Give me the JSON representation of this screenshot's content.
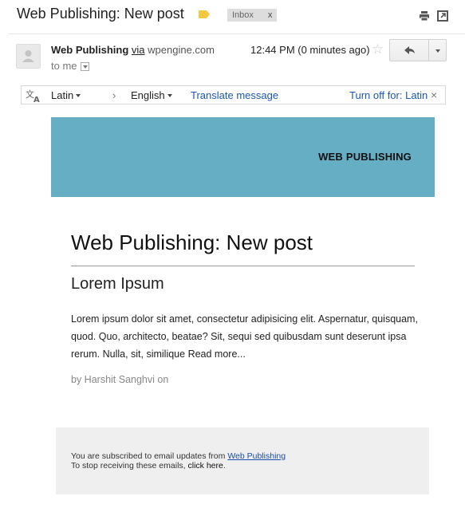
{
  "header": {
    "subject": "Web Publishing: New post",
    "label_chip": "Inbox",
    "label_chip_close": "x",
    "icons": [
      "label-tag-icon",
      "print-icon",
      "new-window-icon"
    ]
  },
  "sender": {
    "name": "Web Publishing",
    "via": "via",
    "domain": "wpengine.com",
    "to": "to me",
    "time": "12:44 PM (0 minutes ago)",
    "star": "☆"
  },
  "translate_bar": {
    "from_lang": "Latin",
    "arrow": "›",
    "to_lang": "English",
    "action": "Translate message",
    "turn_off": "Turn off for: Latin",
    "close": "×"
  },
  "email": {
    "banner_title": "WEB PUBLISHING",
    "banner_color": "#66aec4",
    "post_title": "Web Publishing: New post",
    "post_heading": "Lorem Ipsum",
    "post_body": "Lorem ipsum dolor sit amet, consectetur adipisicing elit. Aspernatur, quisquam, quod. Quo, architecto, beatae? Sit, sequi sed quibusdam sunt deserunt ipsa rerum. Nulla, sit, similique ",
    "read_more": "Read more...",
    "byline": "by Harshit Sanghvi on"
  },
  "footer": {
    "line1_prefix": "You are subscribed to email updates from ",
    "line1_link": "Web Publishing",
    "line2_prefix": "To stop receiving these emails, ",
    "line2_link": "click here",
    "line2_suffix": "."
  }
}
